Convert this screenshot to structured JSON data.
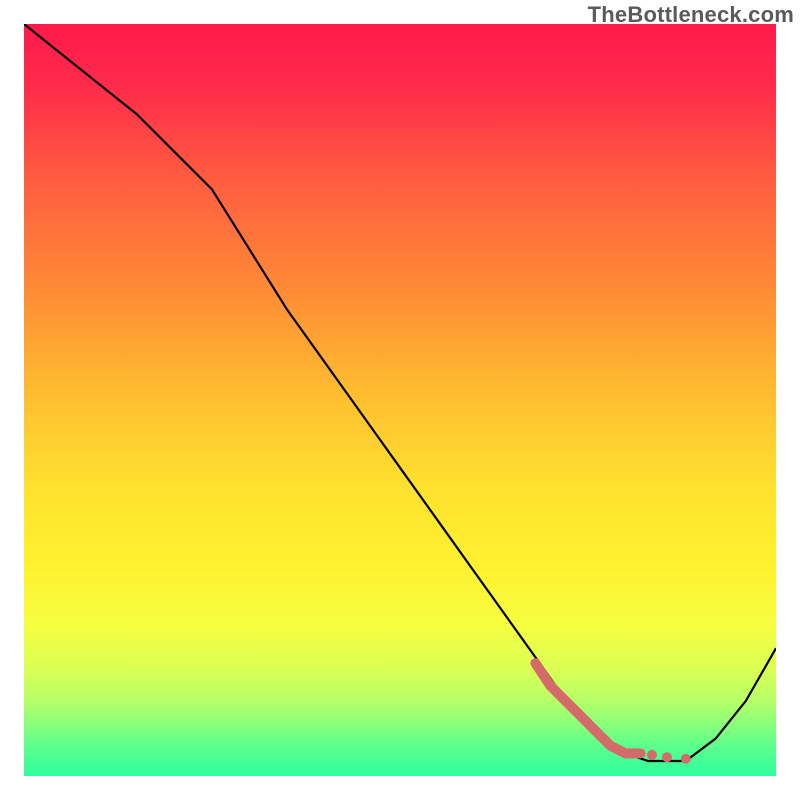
{
  "watermark": "TheBottleneck.com",
  "chart_data": {
    "type": "line",
    "title": "",
    "xlabel": "",
    "ylabel": "",
    "xlim": [
      0,
      100
    ],
    "ylim": [
      0,
      100
    ],
    "grid": false,
    "series": [
      {
        "name": "curve",
        "x": [
          0,
          5,
          10,
          15,
          20,
          25,
          30,
          35,
          40,
          45,
          50,
          55,
          60,
          65,
          70,
          72,
          75,
          78,
          80,
          83,
          85,
          88,
          92,
          96,
          100
        ],
        "values": [
          100,
          96,
          92,
          88,
          83,
          78,
          70,
          62,
          55,
          48,
          41,
          34,
          27,
          20,
          13,
          10,
          7,
          4,
          3,
          2,
          2,
          2,
          5,
          10,
          17
        ]
      },
      {
        "name": "highlight-segment",
        "x": [
          68,
          70,
          72,
          74,
          76,
          78,
          80,
          82
        ],
        "values": [
          15,
          12,
          10,
          8,
          6,
          4,
          3,
          3
        ]
      },
      {
        "name": "highlight-dots",
        "x": [
          83.5,
          85.5,
          88
        ],
        "values": [
          2.8,
          2.5,
          2.3
        ]
      }
    ],
    "gradient_stops": [
      {
        "offset": 0.0,
        "color": "#ff1a4b"
      },
      {
        "offset": 0.08,
        "color": "#ff2a4a"
      },
      {
        "offset": 0.2,
        "color": "#ff5a40"
      },
      {
        "offset": 0.35,
        "color": "#ff8a36"
      },
      {
        "offset": 0.5,
        "color": "#ffc030"
      },
      {
        "offset": 0.62,
        "color": "#ffe22e"
      },
      {
        "offset": 0.72,
        "color": "#fff12f"
      },
      {
        "offset": 0.8,
        "color": "#f6ff40"
      },
      {
        "offset": 0.86,
        "color": "#d9ff55"
      },
      {
        "offset": 0.9,
        "color": "#b6ff68"
      },
      {
        "offset": 0.93,
        "color": "#8cff7a"
      },
      {
        "offset": 0.96,
        "color": "#5dff8c"
      },
      {
        "offset": 1.0,
        "color": "#2dff9e"
      }
    ],
    "colors": {
      "curve": "#000000",
      "highlight": "#d46a6a"
    }
  }
}
